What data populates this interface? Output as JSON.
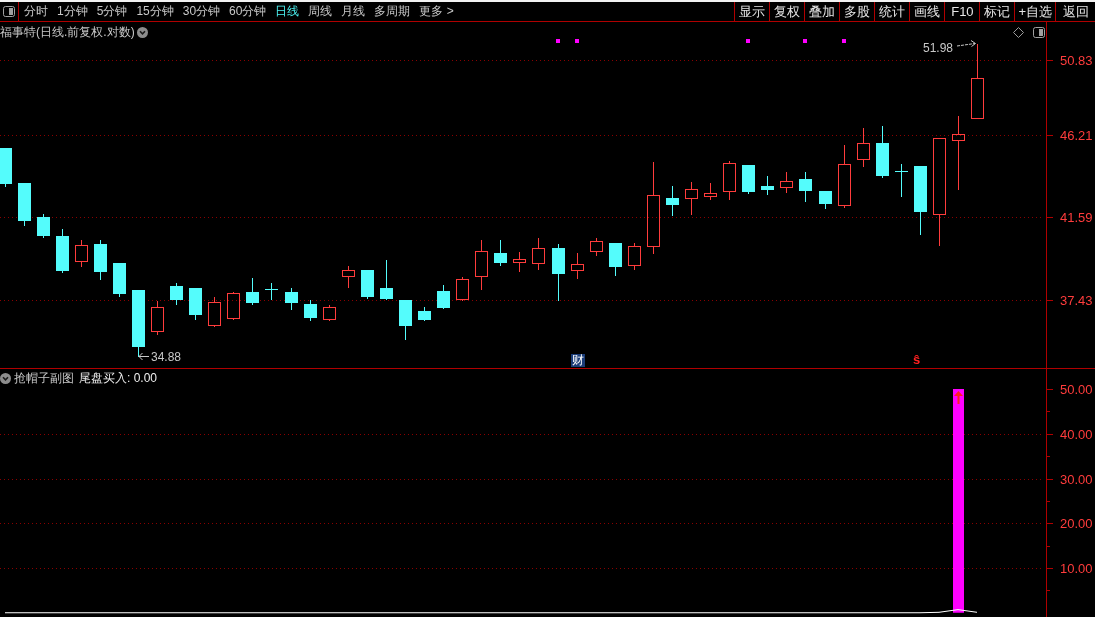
{
  "toolbar": {
    "period_tabs": [
      {
        "label": "分时",
        "selected": false
      },
      {
        "label": "1分钟",
        "selected": false
      },
      {
        "label": "5分钟",
        "selected": false
      },
      {
        "label": "15分钟",
        "selected": false
      },
      {
        "label": "30分钟",
        "selected": false
      },
      {
        "label": "60分钟",
        "selected": false
      },
      {
        "label": "日线",
        "selected": true
      },
      {
        "label": "周线",
        "selected": false
      },
      {
        "label": "月线",
        "selected": false
      },
      {
        "label": "多周期",
        "selected": false
      },
      {
        "label": "更多 >",
        "selected": false
      }
    ],
    "tool_buttons": [
      "显示",
      "复权",
      "叠加",
      "多股",
      "统计",
      "画线",
      "F10",
      "标记",
      "+自选",
      "返回"
    ]
  },
  "main_chart": {
    "title": "福事特(日线.前复权.对数)",
    "high_label": "51.98",
    "low_label": "34.88",
    "price_axis": [
      "50.83",
      "46.21",
      "41.59",
      "37.43"
    ],
    "event_markers": [
      {
        "kind": "badge",
        "text": "财"
      },
      {
        "kind": "glyph",
        "text": "ŝ"
      }
    ]
  },
  "sub_chart": {
    "title": "抢帽子副图",
    "reading": "尾盘买入: 0.00",
    "chart_data": {
      "type": "bar",
      "grid": true,
      "categories": [
        null,
        null,
        null,
        null,
        null,
        null,
        null,
        null,
        null,
        null,
        null,
        null,
        null,
        null,
        null,
        null,
        null,
        null,
        null,
        null,
        null,
        null,
        null,
        null,
        null,
        null,
        null,
        null,
        null,
        null,
        null,
        null,
        null,
        null,
        null,
        null,
        null,
        null,
        null,
        null,
        null,
        null,
        null,
        null,
        null,
        null,
        null,
        null,
        null,
        null,
        null,
        null
      ],
      "ylim": [
        0,
        50
      ],
      "yticks": [
        {
          "value": 10,
          "label": "10.00"
        },
        {
          "value": 20,
          "label": "20.00"
        },
        {
          "value": 30,
          "label": "30.00"
        },
        {
          "value": 40,
          "label": "40.00"
        },
        {
          "value": 50,
          "label": "50.00"
        }
      ],
      "series": [
        {
          "color": "#ff00ff",
          "values": [
            0,
            0,
            0,
            0,
            0,
            0,
            0,
            0,
            0,
            0,
            0,
            0,
            0,
            0,
            0,
            0,
            0,
            0,
            0,
            0,
            0,
            0,
            0,
            0,
            0,
            0,
            0,
            0,
            0,
            0,
            0,
            0,
            0,
            0,
            0,
            0,
            0,
            0,
            0,
            0,
            0,
            0,
            0,
            0,
            0,
            0,
            0,
            0,
            0,
            0,
            50,
            0
          ]
        },
        {
          "type": "line",
          "color": "#ffffff",
          "values": [
            0,
            0,
            0,
            0,
            0,
            0,
            0,
            0,
            0,
            0,
            0,
            0,
            0,
            0,
            0,
            0,
            0,
            0,
            0,
            0,
            0,
            0,
            0,
            0,
            0,
            0,
            0,
            0,
            0,
            0,
            0,
            0,
            0,
            0,
            0,
            0,
            0,
            0,
            0,
            0,
            0,
            0,
            0,
            0,
            0,
            0,
            0,
            0,
            0,
            0.1,
            0.7,
            0.1
          ]
        }
      ]
    }
  }
}
